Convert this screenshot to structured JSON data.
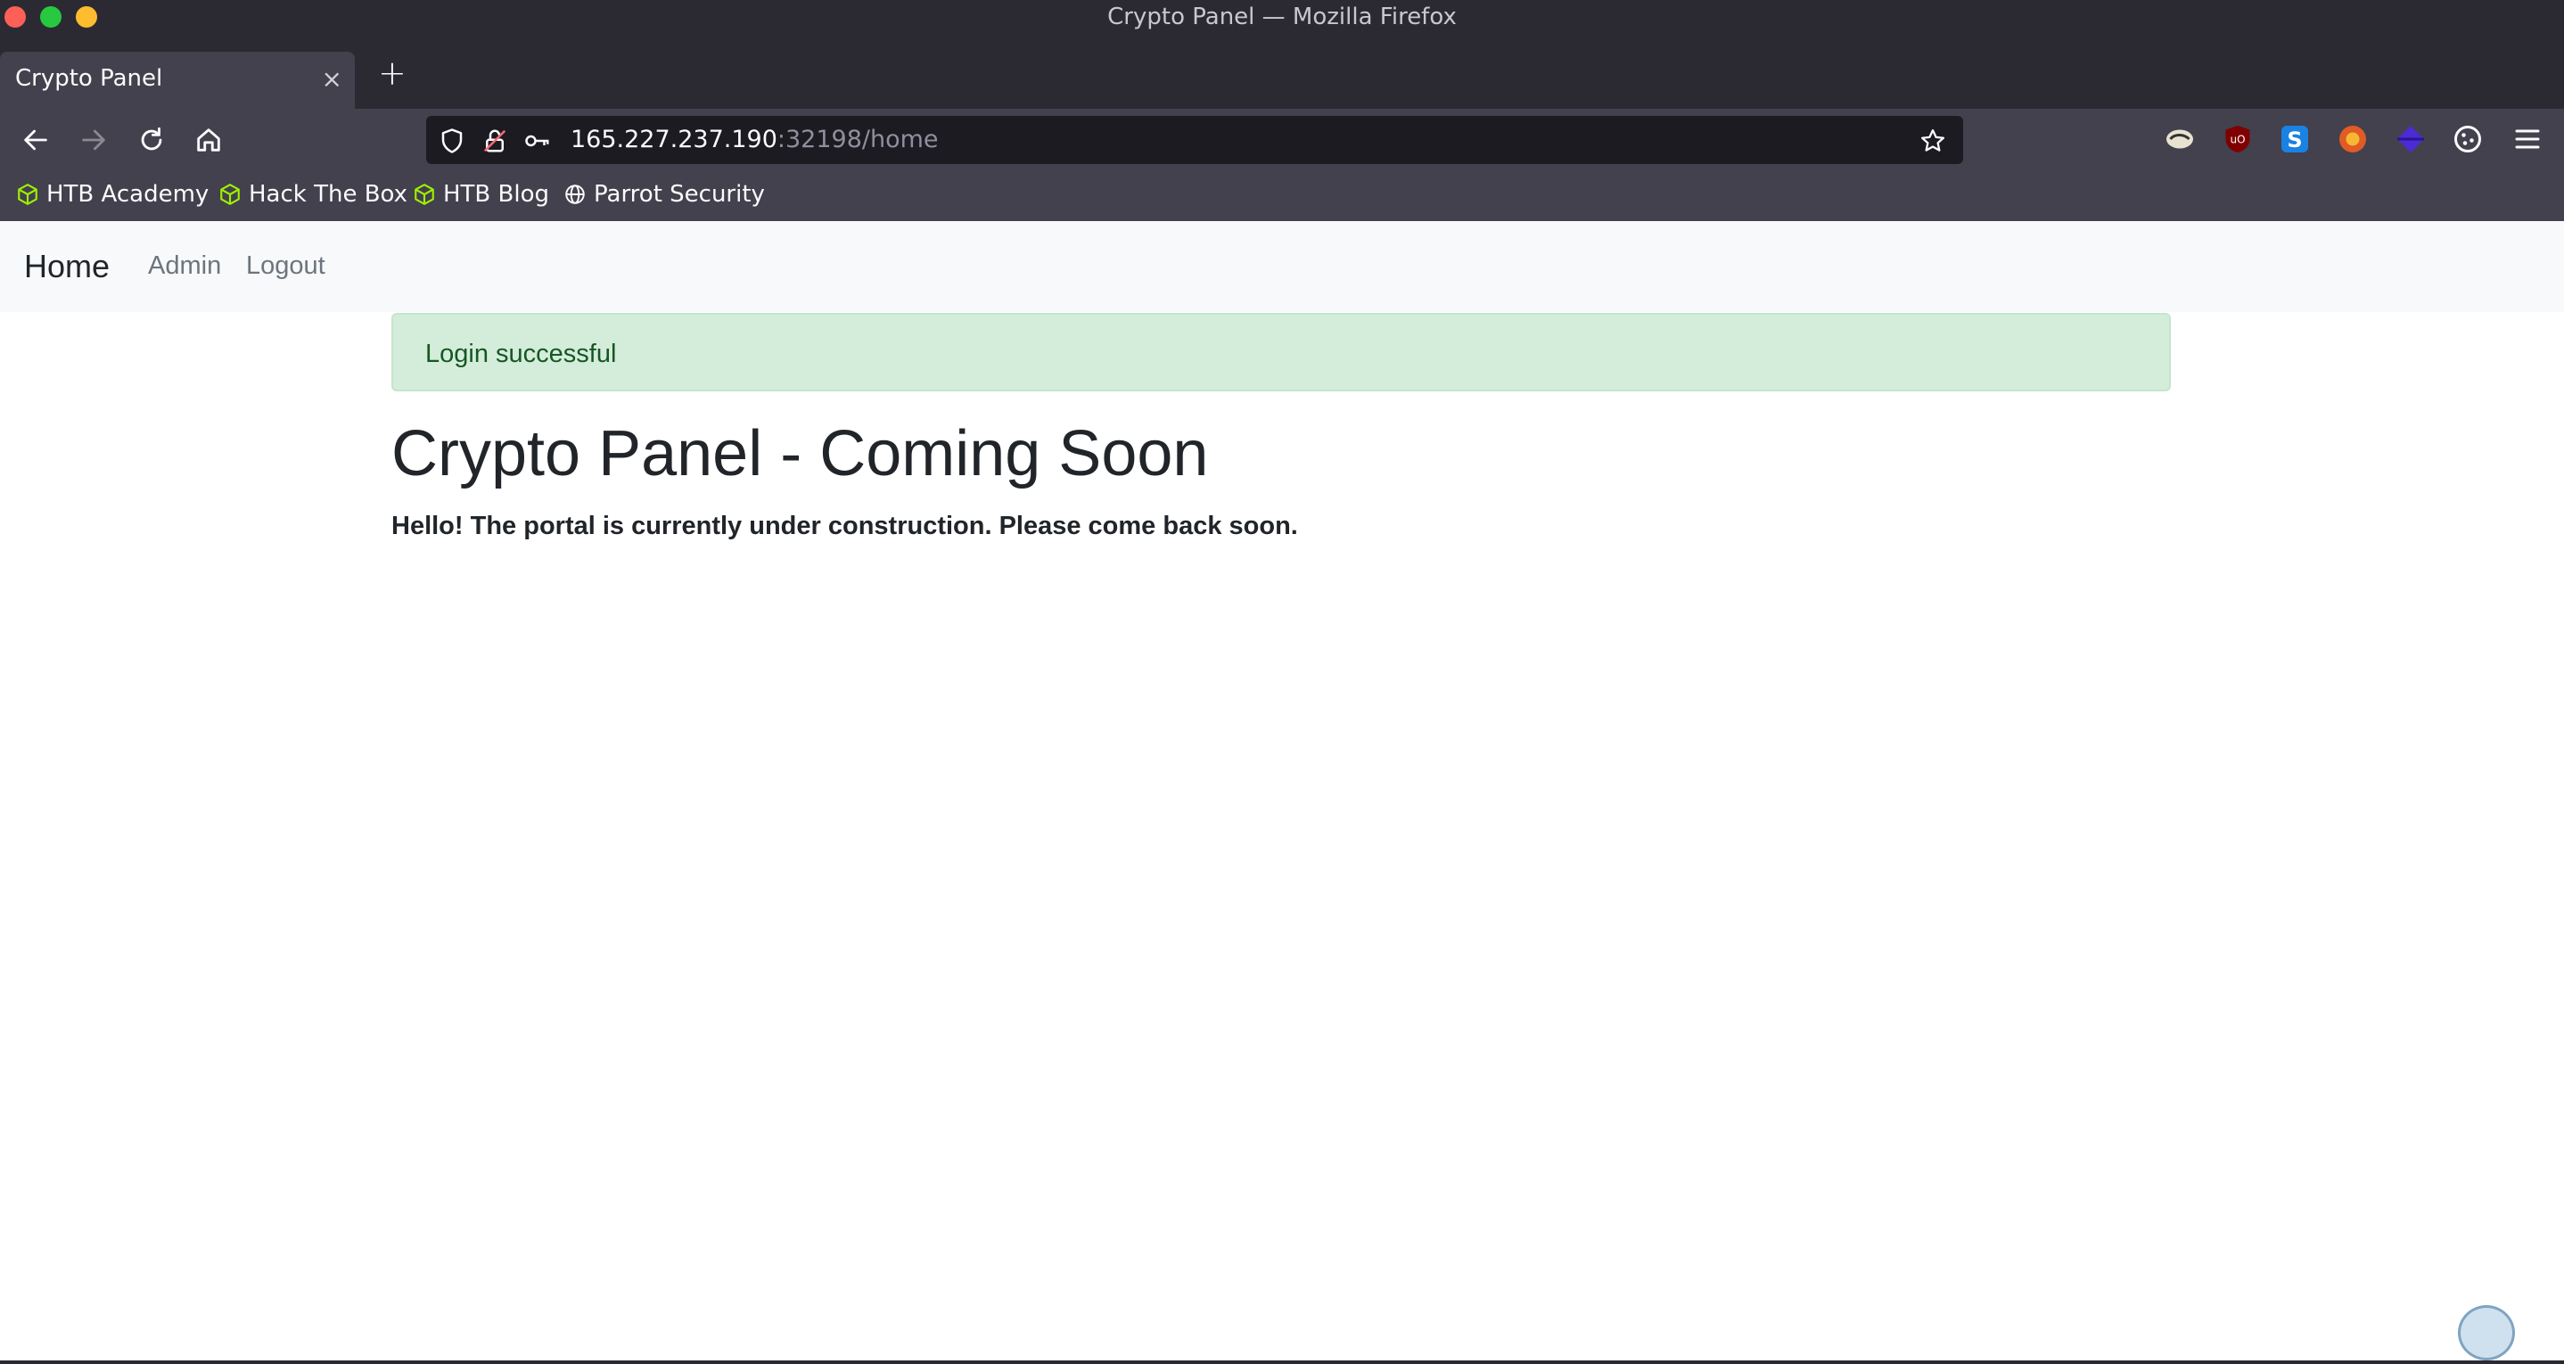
{
  "window": {
    "title": "Crypto Panel — Mozilla Firefox"
  },
  "tabs": [
    {
      "label": "Crypto Panel",
      "close": "×"
    }
  ],
  "new_tab_label": "+",
  "urlbar": {
    "host": "165.227.237.190",
    "rest": ":32198/home"
  },
  "bookmarks": [
    {
      "label": "HTB Academy",
      "icon": "htb-cube-icon"
    },
    {
      "label": "Hack The Box",
      "icon": "htb-cube-icon"
    },
    {
      "label": "HTB Blog",
      "icon": "htb-cube-icon"
    },
    {
      "label": "Parrot Security",
      "icon": "globe-icon"
    }
  ],
  "extensions": [
    "parrot-icon",
    "ublock-icon",
    "s-extension-icon",
    "fox-extension-icon",
    "cube-extension-icon",
    "cookie-icon"
  ],
  "site_nav": {
    "brand": "Home",
    "links": [
      "Admin",
      "Logout"
    ]
  },
  "alert": {
    "message": "Login successful",
    "color": "#155724",
    "background": "#d4edda"
  },
  "main": {
    "heading": "Crypto Panel - Coming Soon",
    "subtext": "Hello! The portal is currently under construction. Please come back soon."
  },
  "colors": {
    "chrome_dark": "#2b2a33",
    "chrome_mid": "#42414d",
    "htb_green": "#9fef00"
  }
}
